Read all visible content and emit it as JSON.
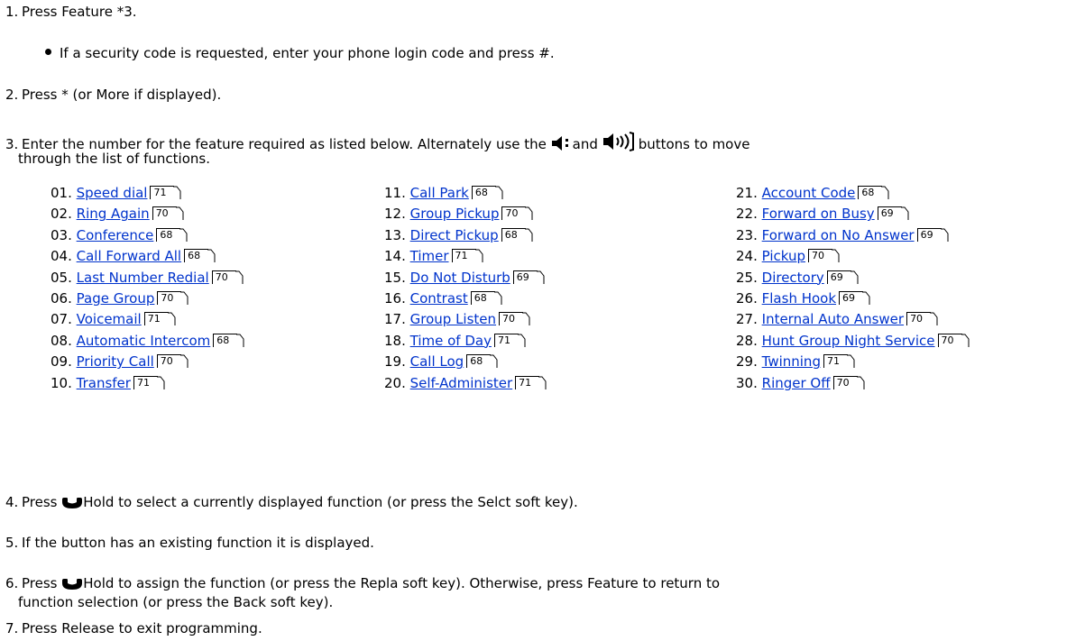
{
  "steps": {
    "s1": {
      "num": "1.",
      "text": "Press Feature *3."
    },
    "s1_sub": "If a security code is requested, enter your phone login code and press #.",
    "s2": {
      "num": "2.",
      "text": "Press * (or More if displayed)."
    },
    "s3": {
      "num": "3.",
      "text_a": "Enter the number for the feature required as listed below. Alternately use the",
      "text_b": "and",
      "text_c": "buttons to move",
      "line2": "through the list of functions."
    },
    "s4": {
      "num": "4.",
      "text_a": "Press",
      "text_b": "Hold to select a currently displayed function (or press the Selct soft key)."
    },
    "s5": {
      "num": "5.",
      "text": "If the button has an existing function it is displayed."
    },
    "s6": {
      "num": "6.",
      "text_a": "Press",
      "text_b": "Hold to assign the function (or press the Repla soft key). Otherwise, press Feature to return to",
      "line2": "function selection (or press the Back soft key)."
    },
    "s7": {
      "num": "7.",
      "text": "Press Release to exit programming."
    }
  },
  "icons": {
    "volume_down": "volume-down-icon",
    "volume_up": "volume-up-icon",
    "hold": "hold-handset-icon",
    "page_ref": "page-reference-icon"
  },
  "link_color": "#0033cc",
  "features": [
    {
      "num": "01.",
      "label": "Speed dial",
      "page": "71"
    },
    {
      "num": "02.",
      "label": "Ring Again",
      "page": "70"
    },
    {
      "num": "03.",
      "label": "Conference",
      "page": "68"
    },
    {
      "num": "04.",
      "label": "Call Forward All",
      "page": "68"
    },
    {
      "num": "05.",
      "label": "Last Number Redial",
      "page": "70"
    },
    {
      "num": "06.",
      "label": "Page Group",
      "page": "70"
    },
    {
      "num": "07.",
      "label": "Voicemail",
      "page": "71"
    },
    {
      "num": "08.",
      "label": "Automatic Intercom",
      "page": "68"
    },
    {
      "num": "09.",
      "label": "Priority Call",
      "page": "70"
    },
    {
      "num": "10.",
      "label": "Transfer",
      "page": "71"
    },
    {
      "num": "11.",
      "label": "Call Park",
      "page": "68"
    },
    {
      "num": "12.",
      "label": "Group Pickup",
      "page": "70"
    },
    {
      "num": "13.",
      "label": "Direct Pickup",
      "page": "68"
    },
    {
      "num": "14.",
      "label": "Timer",
      "page": "71"
    },
    {
      "num": "15.",
      "label": "Do Not Disturb",
      "page": "69"
    },
    {
      "num": "16.",
      "label": "Contrast",
      "page": "68"
    },
    {
      "num": "17.",
      "label": "Group Listen",
      "page": "70"
    },
    {
      "num": "18.",
      "label": "Time of Day",
      "page": "71"
    },
    {
      "num": "19.",
      "label": "Call Log",
      "page": "68"
    },
    {
      "num": "20.",
      "label": "Self-Administer",
      "page": "71"
    },
    {
      "num": "21.",
      "label": "Account Code",
      "page": "68"
    },
    {
      "num": "22.",
      "label": "Forward on Busy",
      "page": "69"
    },
    {
      "num": "23.",
      "label": "Forward on No Answer",
      "page": "69"
    },
    {
      "num": "24.",
      "label": "Pickup",
      "page": "70"
    },
    {
      "num": "25.",
      "label": "Directory",
      "page": "69"
    },
    {
      "num": "26.",
      "label": "Flash Hook",
      "page": "69"
    },
    {
      "num": "27.",
      "label": "Internal Auto Answer",
      "page": "70"
    },
    {
      "num": "28.",
      "label": "Hunt Group Night Service",
      "page": "70"
    },
    {
      "num": "29.",
      "label": "Twinning",
      "page": "71"
    },
    {
      "num": "30.",
      "label": "Ringer Off",
      "page": "70"
    }
  ]
}
